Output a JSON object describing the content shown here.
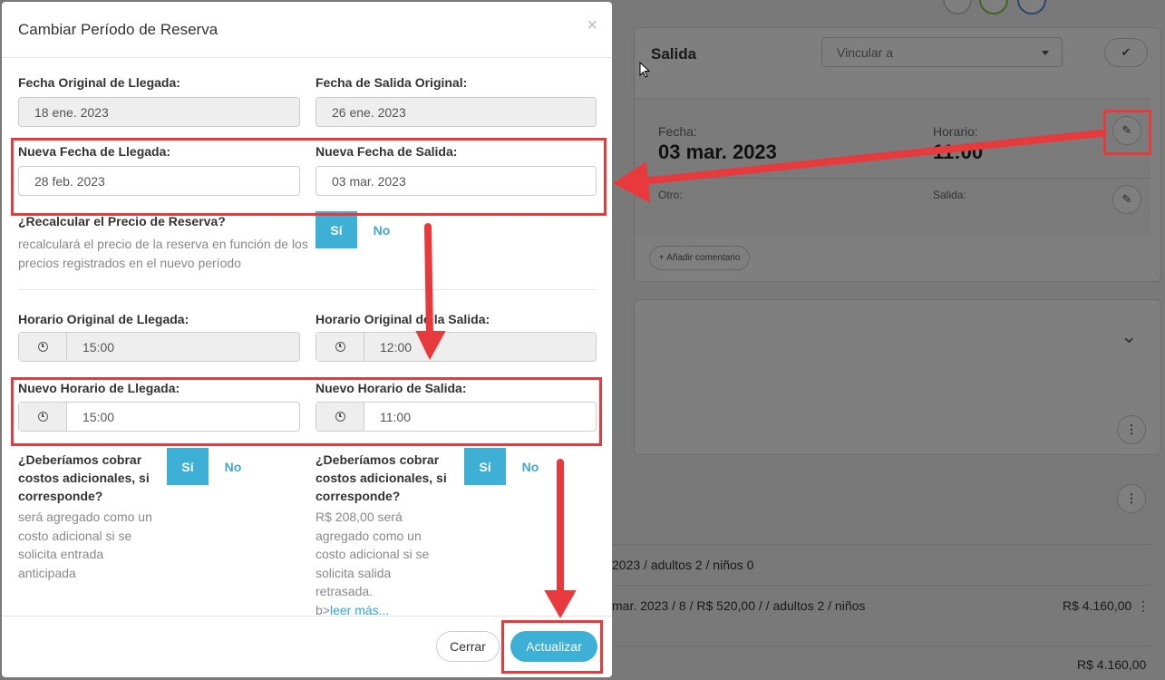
{
  "modal": {
    "title": "Cambiar Período de Reserva",
    "close_label": "×",
    "original_arrival_label": "Fecha Original de Llegada:",
    "original_arrival_value": "18 ene. 2023",
    "original_departure_label": "Fecha de Salida Original:",
    "original_departure_value": "26 ene. 2023",
    "new_arrival_label": "Nueva Fecha de Llegada:",
    "new_arrival_value": "28 feb. 2023",
    "new_departure_label": "Nueva Fecha de Salida:",
    "new_departure_value": "03 mar. 2023",
    "recalc_label": "¿Recalcular el Precio de Reserva?",
    "recalc_desc": "recalculará el precio de la reserva en función de los precios registrados en el nuevo período",
    "yes": "Sí",
    "no": "No",
    "orig_arrival_time_label": "Horario Original de Llegada:",
    "orig_arrival_time_value": "15:00",
    "orig_departure_time_label": "Horario Original de la Salida:",
    "orig_departure_time_value": "12:00",
    "new_arrival_time_label": "Nuevo Horario de Llegada:",
    "new_arrival_time_value": "15:00",
    "new_departure_time_label": "Nuevo Horario de Salida:",
    "new_departure_time_value": "11:00",
    "charge_question": "¿Deberíamos cobrar costos adicionales, si corresponde?",
    "charge_arrival_desc": "será agregado como un costo adicional si se solicita entrada anticipada",
    "charge_departure_desc": "R$ 208,00 será agregado como un costo adicional si se solicita salida retrasada.",
    "charge_departure_prefix": "b>",
    "read_more": "leer más...",
    "close_button": "Cerrar",
    "update_button": "Actualizar"
  },
  "background": {
    "section_title": "Salida",
    "link_select_placeholder": "Vincular a",
    "date_label": "Fecha:",
    "date_value": "03 mar. 2023",
    "time_label": "Horario:",
    "time_value": "11:00",
    "other_label": "Otro:",
    "departure_label": "Salida:",
    "add_comment": "Añadir comentario",
    "row1": "2023  /  adultos 2  /  niños 0",
    "row2": "mar. 2023  /  8  /  R$ 520,00  /   /  adultos 2  /  niños",
    "row2_total": "R$ 4.160,00",
    "total": "R$ 4.160,00"
  },
  "colors": {
    "accent": "#3fb0d5",
    "annotation": "#e8393d"
  }
}
